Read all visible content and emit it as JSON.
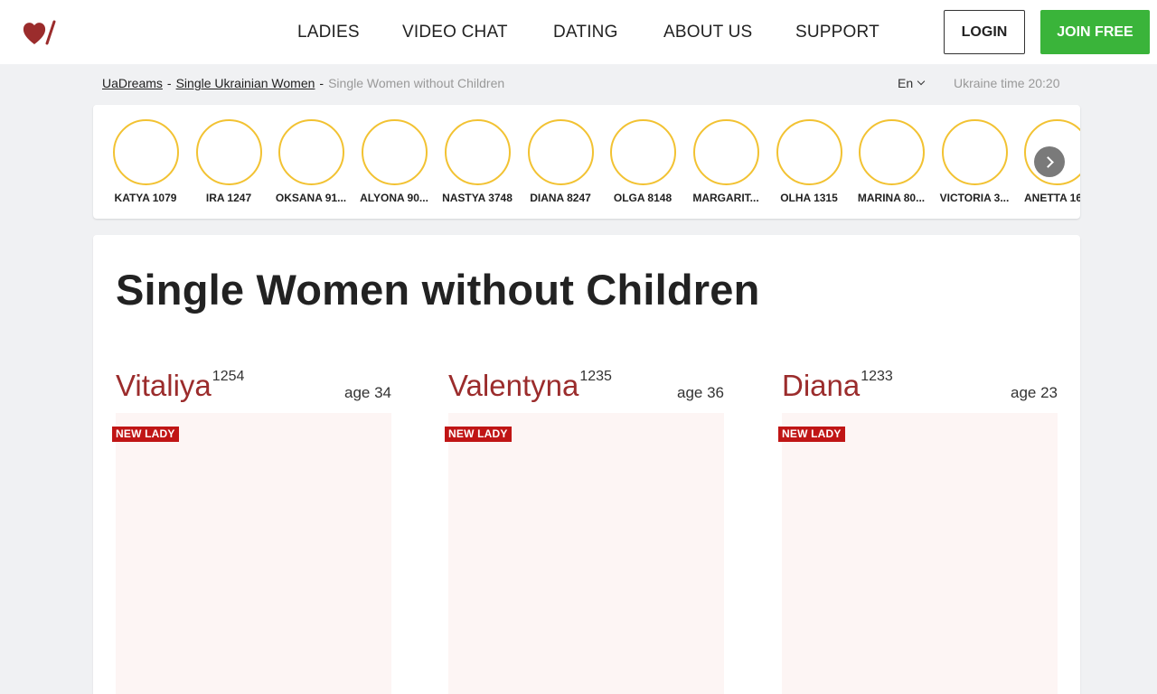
{
  "header": {
    "logo_name": "heart-logo",
    "nav": [
      "LADIES",
      "VIDEO CHAT",
      "DATING",
      "ABOUT US",
      "SUPPORT"
    ],
    "login_label": "LOGIN",
    "join_label": "JOIN FREE",
    "colors": {
      "join_bg": "#3ab43a",
      "logo": "#9b2c2c"
    }
  },
  "breadcrumb": {
    "items": [
      "UaDreams",
      "Single Ukrainian Women"
    ],
    "separator": "-",
    "current": "Single Women without Children"
  },
  "language": "En",
  "ukraine_time": "Ukraine time 20:20",
  "stories": {
    "items": [
      "KATYA 1079",
      "IRA 1247",
      "OKSANA 91...",
      "ALYONA 90...",
      "NASTYA 3748",
      "DIANA 8247",
      "OLGA 8148",
      "MARGARIT...",
      "OLHA 1315",
      "MARINA 80...",
      "VICTORIA 3...",
      "ANETTA 16"
    ],
    "ring_color": "#f2c232",
    "next_icon": "chevron-right-icon"
  },
  "page_title": "Single Women without Children",
  "ladies": [
    {
      "name": "Vitaliya",
      "id": "1254",
      "age": "age 34",
      "badge": "NEW LADY"
    },
    {
      "name": "Valentyna",
      "id": "1235",
      "age": "age 36",
      "badge": "NEW LADY"
    },
    {
      "name": "Diana",
      "id": "1233",
      "age": "age 23",
      "badge": "NEW LADY"
    }
  ],
  "accent_color": "#9b2c2c",
  "badge_color": "#c01515"
}
